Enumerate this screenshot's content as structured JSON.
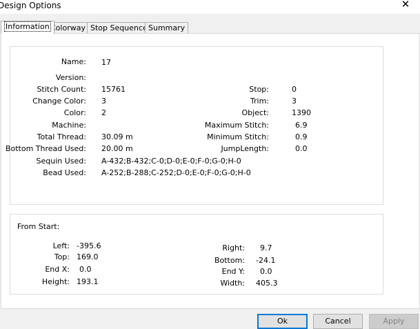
{
  "window": {
    "title": "Design Options",
    "close_glyph": "✕"
  },
  "tabs": [
    "Information",
    "Colorway",
    "Stop Sequence",
    "Summary"
  ],
  "info": {
    "left": [
      {
        "label": "Name:",
        "value": "17"
      },
      {
        "label": "Version:",
        "value": ""
      },
      {
        "label": "Stitch Count:",
        "value": "15761"
      },
      {
        "label": "Change Color:",
        "value": "3"
      },
      {
        "label": "Color:",
        "value": "2"
      },
      {
        "label": "Machine:",
        "value": ""
      },
      {
        "label": "Total Thread:",
        "value": "30.09 m"
      },
      {
        "label": "Bottom Thread Used:",
        "value": "20.00 m"
      },
      {
        "label": "Sequin Used:",
        "value": "A-432;B-432;C-0;D-0;E-0;F-0;G-0;H-0"
      },
      {
        "label": "Bead Used:",
        "value": "A-252;B-288;C-252;D-0;E-0;F-0;G-0;H-0"
      }
    ],
    "right": [
      {
        "label": "Stop:",
        "value": "0"
      },
      {
        "label": "Trim:",
        "value": "3"
      },
      {
        "label": "Object:",
        "value": "1390"
      },
      {
        "label": "Maximum Stitch:",
        "value": "6.9"
      },
      {
        "label": "Minimum Stitch:",
        "value": "0.9"
      },
      {
        "label": "JumpLength:",
        "value": "0.0"
      }
    ]
  },
  "from_start": {
    "title": "From Start:",
    "left": [
      {
        "label": "Left:",
        "value": "-395.6"
      },
      {
        "label": "Top:",
        "value": "169.0"
      },
      {
        "label": "End X:",
        "value": "0.0"
      },
      {
        "label": "Height:",
        "value": "193.1"
      }
    ],
    "right": [
      {
        "label": "Right:",
        "value": "9.7"
      },
      {
        "label": "Bottom:",
        "value": "-24.1"
      },
      {
        "label": "End Y:",
        "value": "0.0"
      },
      {
        "label": "Width:",
        "value": "405.3"
      }
    ]
  },
  "buttons": {
    "ok": "Ok",
    "cancel": "Cancel",
    "apply": "Apply"
  }
}
